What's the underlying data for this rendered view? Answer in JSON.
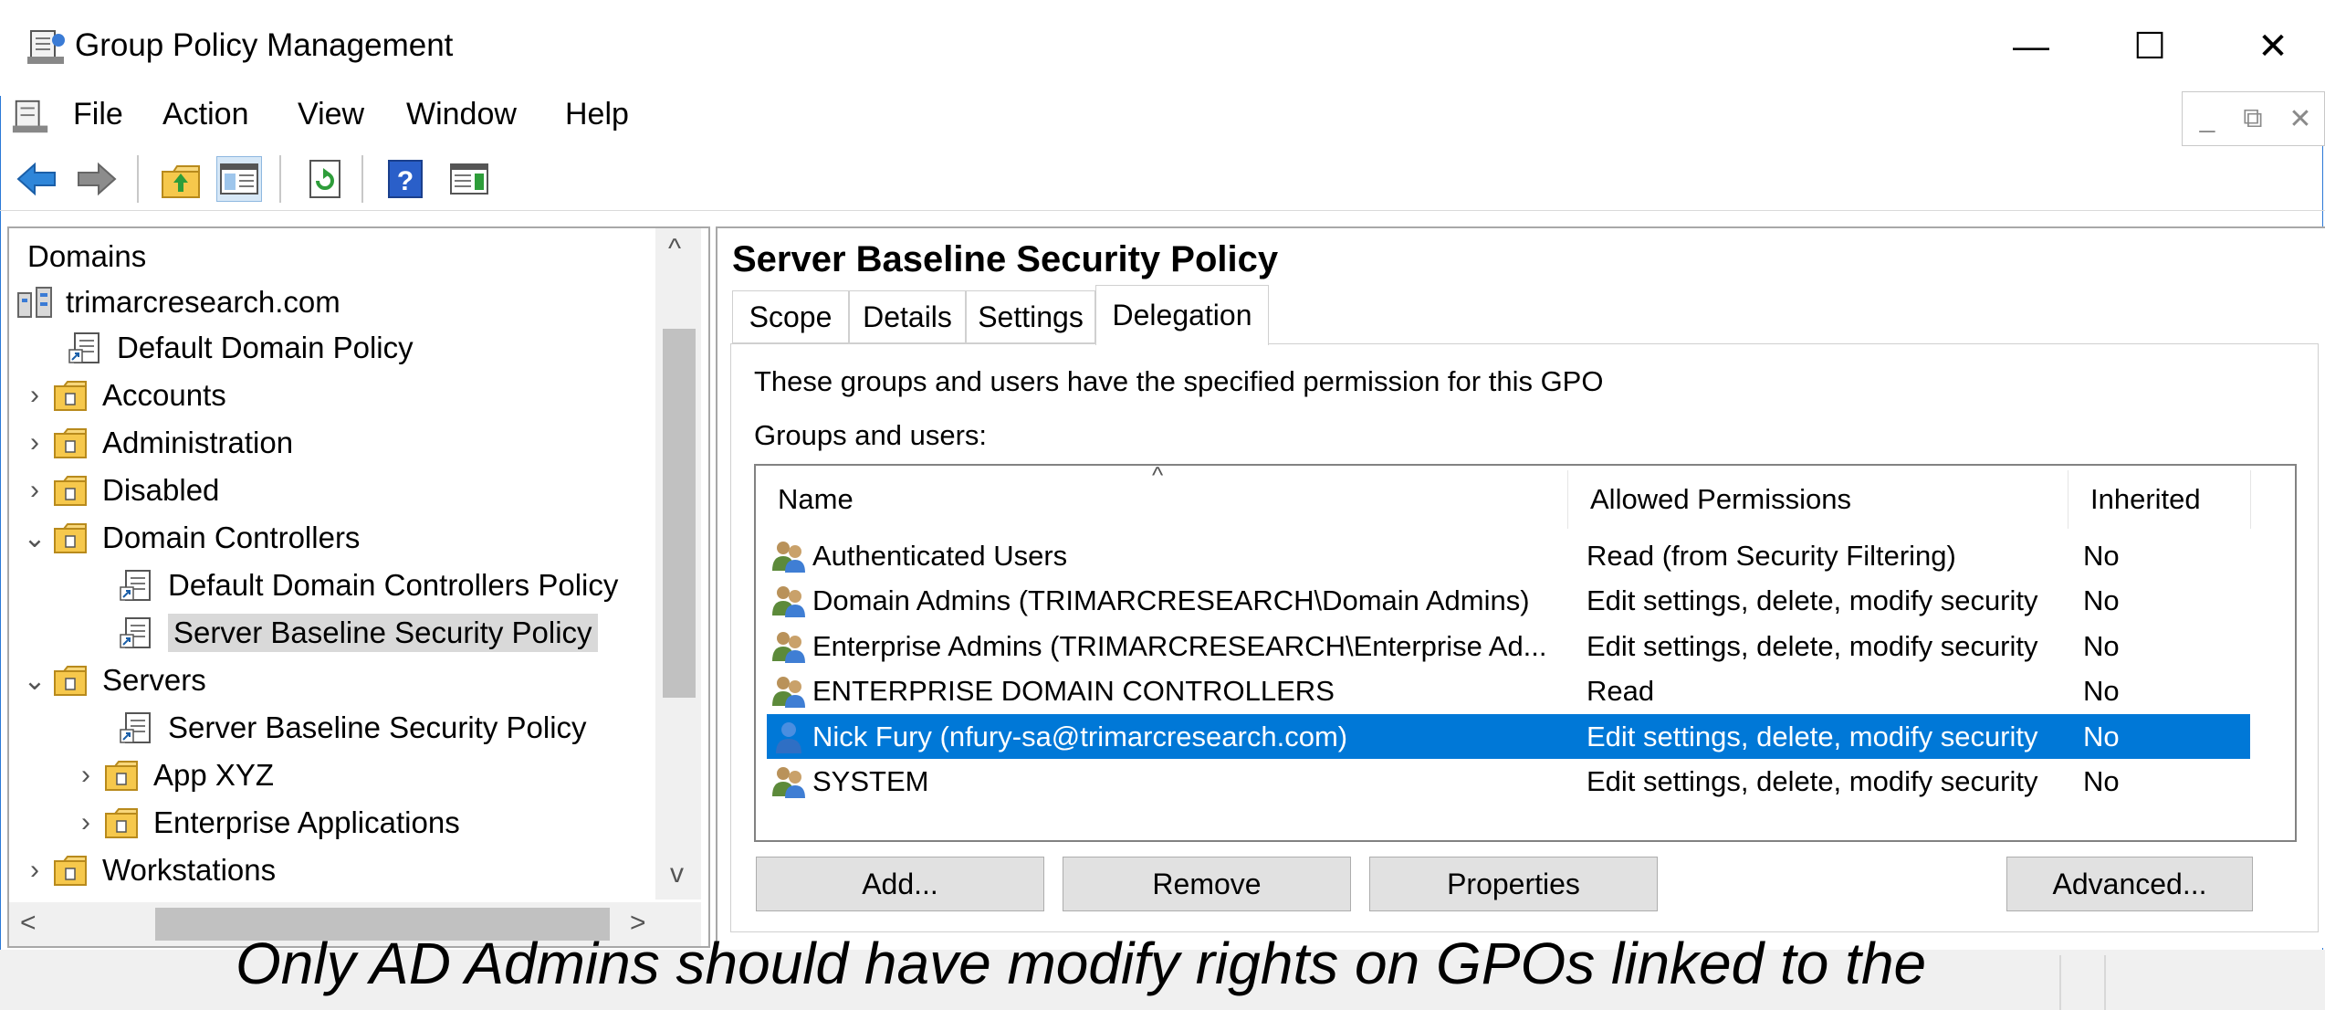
{
  "window": {
    "title": "Group Policy Management",
    "minimize_glyph": "—",
    "maximize_glyph": "☐",
    "close_glyph": "✕"
  },
  "menu": {
    "items": [
      "File",
      "Action",
      "View",
      "Window",
      "Help"
    ],
    "mdi_minimize": "_",
    "mdi_restore": "⧉",
    "mdi_close": "✕"
  },
  "toolbar": {
    "icons": [
      "back-arrow-icon",
      "forward-arrow-icon",
      "up-folder-icon",
      "show-hide-tree-icon",
      "refresh-icon",
      "help-icon",
      "show-action-pane-icon"
    ]
  },
  "tree": {
    "root_label": "Domains",
    "domain_label": "trimarcresearch.com",
    "items": [
      {
        "label": "Default Domain Policy",
        "type": "gpo",
        "chevron": ""
      },
      {
        "label": "Accounts",
        "type": "ou",
        "chevron": "›"
      },
      {
        "label": "Administration",
        "type": "ou",
        "chevron": "›"
      },
      {
        "label": "Disabled",
        "type": "ou",
        "chevron": "›"
      },
      {
        "label": "Domain Controllers",
        "type": "ou",
        "chevron": "⌄"
      },
      {
        "label": "Default Domain Controllers Policy",
        "type": "gpo",
        "chevron": ""
      },
      {
        "label": "Server Baseline Security Policy",
        "type": "gpo",
        "chevron": "",
        "selected": true
      },
      {
        "label": "Servers",
        "type": "ou",
        "chevron": "⌄"
      },
      {
        "label": "Server Baseline Security Policy",
        "type": "gpo",
        "chevron": ""
      },
      {
        "label": "App XYZ",
        "type": "ou",
        "chevron": "›"
      },
      {
        "label": "Enterprise Applications",
        "type": "ou",
        "chevron": "›"
      },
      {
        "label": "Workstations",
        "type": "ou",
        "chevron": "›"
      }
    ],
    "scroll_up": "^",
    "scroll_down": "v",
    "scroll_left": "<",
    "scroll_right": ">"
  },
  "detail": {
    "title": "Server Baseline Security Policy",
    "tabs": [
      "Scope",
      "Details",
      "Settings",
      "Delegation"
    ],
    "active_tab": "Delegation",
    "description": "These groups and users have the specified permission for this GPO",
    "groups_label": "Groups and users:",
    "sort_arrow": "^",
    "columns": [
      "Name",
      "Allowed Permissions",
      "Inherited"
    ],
    "rows": [
      {
        "name": "Authenticated Users",
        "permissions": "Read (from Security Filtering)",
        "inherited": "No",
        "icon": "group-icon"
      },
      {
        "name": "Domain Admins (TRIMARCRESEARCH\\Domain Admins)",
        "permissions": "Edit settings, delete, modify security",
        "inherited": "No",
        "icon": "group-icon"
      },
      {
        "name": "Enterprise Admins (TRIMARCRESEARCH\\Enterprise Ad...",
        "permissions": "Edit settings, delete, modify security",
        "inherited": "No",
        "icon": "group-icon"
      },
      {
        "name": "ENTERPRISE DOMAIN CONTROLLERS",
        "permissions": "Read",
        "inherited": "No",
        "icon": "group-icon"
      },
      {
        "name": "Nick Fury (nfury-sa@trimarcresearch.com)",
        "permissions": "Edit settings, delete, modify security",
        "inherited": "No",
        "icon": "user-icon",
        "selected": true
      },
      {
        "name": "SYSTEM",
        "permissions": "Edit settings, delete, modify security",
        "inherited": "No",
        "icon": "group-icon"
      }
    ],
    "buttons": {
      "add": "Add...",
      "remove": "Remove",
      "properties": "Properties",
      "advanced": "Advanced..."
    }
  },
  "caption": "Only AD Admins should have modify rights on GPOs linked to the",
  "colors": {
    "selection": "#0078d7",
    "window_border": "#2b79d7"
  }
}
